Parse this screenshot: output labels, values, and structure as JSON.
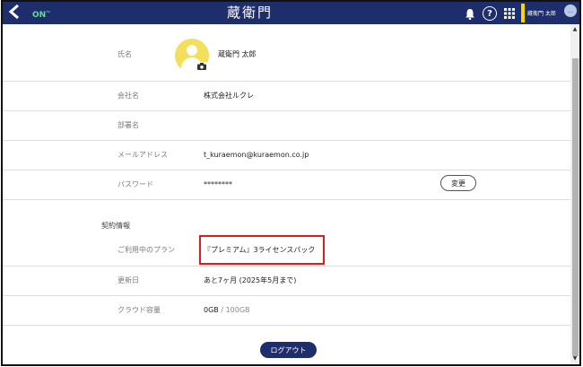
{
  "header": {
    "back_icon": "back-arrow-icon",
    "badge": "ON",
    "logo": "蔵衛門",
    "icons": [
      "bell-icon",
      "help-icon",
      "apps-grid-icon",
      "chat-icon"
    ],
    "help_glyph": "?",
    "user_name": "蔵衛門 太郎",
    "colors": {
      "bar": "#1e2d6b",
      "badge": "#5fe08a",
      "user_accent": "#f5d800"
    }
  },
  "profile": {
    "rows": [
      {
        "label": "氏名",
        "value": "蔵衛門 太郎"
      },
      {
        "label": "会社名",
        "value": "株式会社ルクレ"
      },
      {
        "label": "部署名",
        "value": ""
      },
      {
        "label": "メールアドレス",
        "value": "t_kuraemon@kuraemon.co.jp"
      },
      {
        "label": "パスワード",
        "value": "********"
      }
    ],
    "change_button": "変更"
  },
  "contract": {
    "title": "契約情報",
    "rows": [
      {
        "label": "ご利用中のプラン",
        "value": "『プレミアム』3ライセンスパック"
      },
      {
        "label": "更新日",
        "value": "あと7ヶ月 (2025年5月まで)"
      },
      {
        "label": "クラウド容量",
        "used": "0GB",
        "separator": " / ",
        "total": "100GB"
      }
    ],
    "highlight_color": "#e11b1b"
  },
  "logout": "ログアウト"
}
